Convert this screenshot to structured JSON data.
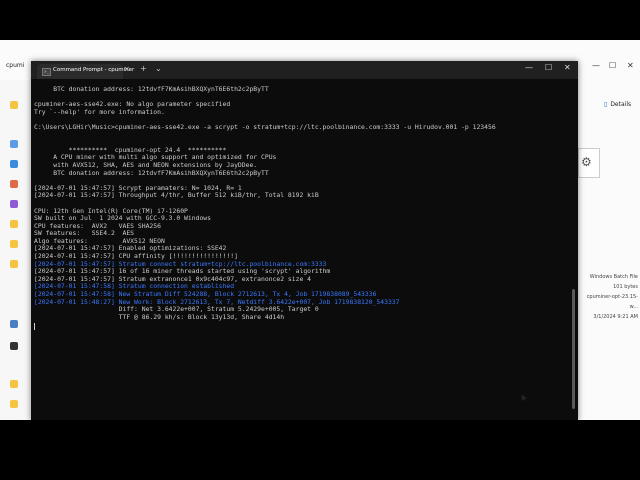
{
  "explorer": {
    "tab_label": "cpumi",
    "details_label": "Details",
    "file_type": "Windows Batch File",
    "file_size": "101 bytes",
    "file_name": "cpuminer-opt-23.15-w...",
    "file_date": "3/1/2024 9:21 AM"
  },
  "terminal": {
    "tab_title": "Command Prompt - cpuminer",
    "new_tab": "+",
    "dropdown": "⌄",
    "minimize": "—",
    "maximize": "☐",
    "close": "✕",
    "tab_close": "×"
  },
  "lines": [
    {
      "text": "     BTC donation address: 12tdvfF7KmAsihBXQXynT6E6th2c2pByTT",
      "color": "gray"
    },
    {
      "text": "",
      "color": "gray"
    },
    {
      "text": "cpuminer-aes-sse42.exe: No algo parameter specified",
      "color": "gray"
    },
    {
      "text": "Try `--help' for more information.",
      "color": "gray"
    },
    {
      "text": "",
      "color": "gray"
    },
    {
      "text": "C:\\Users\\LGHir\\Music>cpuminer-aes-sse42.exe -a scrypt -o stratum+tcp://ltc.poolbinance.com:3333 -u Hirudov.001 -p 123456",
      "color": "gray"
    },
    {
      "text": "",
      "color": "gray"
    },
    {
      "text": "",
      "color": "gray"
    },
    {
      "text": "         **********  cpuminer-opt 24.4  **********",
      "color": "gray"
    },
    {
      "text": "     A CPU miner with multi algo support and optimized for CPUs",
      "color": "gray"
    },
    {
      "text": "     with AVX512, SHA, AES and NEON extensions by JayDDee.",
      "color": "gray"
    },
    {
      "text": "     BTC donation address: 12tdvfF7KmAsihBXQXynT6E6th2c2pByTT",
      "color": "gray"
    },
    {
      "text": "",
      "color": "gray"
    },
    {
      "text": "[2024-07-01 15:47:57] Scrypt paramaters: N= 1024, R= 1",
      "color": "gray"
    },
    {
      "text": "[2024-07-01 15:47:57] Throughput 4/thr, Buffer 512 kiB/thr, Total 8192 kiB",
      "color": "gray"
    },
    {
      "text": "",
      "color": "gray"
    },
    {
      "text": "CPU: 12th Gen Intel(R) Core(TM) i7-1260P",
      "color": "gray"
    },
    {
      "text": "SW built on Jul  1 2024 with GCC-9.3.0 Windows",
      "color": "gray"
    },
    {
      "text": "CPU features:  AVX2   VAES SHA256",
      "color": "gray"
    },
    {
      "text": "SW features:   SSE4.2  AES",
      "color": "gray"
    },
    {
      "text": "Algo features:         AVX512 NEON",
      "color": "gray"
    },
    {
      "text": "[2024-07-01 15:47:57] Enabled optimizations: SSE42",
      "color": "gray"
    },
    {
      "text": "[2024-07-01 15:47:57] CPU affinity [!!!!!!!!!!!!!!!!]",
      "color": "gray"
    },
    {
      "text": "[2024-07-01 15:47:57] Stratum connect stratum+tcp://ltc.poolbinance.com:3333",
      "color": "blue"
    },
    {
      "text": "[2024-07-01 15:47:57] 16 of 16 miner threads started using 'scrypt' algorithm",
      "color": "gray"
    },
    {
      "text": "[2024-07-01 15:47:57] Stratum extranonce1 0x9c404c97, extranonce2 size 4",
      "color": "gray"
    },
    {
      "text": "[2024-07-01 15:47:58] Stratum connection established",
      "color": "blue"
    },
    {
      "text": "[2024-07-01 15:47:58] New Stratum Diff 524288, Block 2712613, Tx 4, Job 1719838089_543336",
      "color": "blue"
    },
    {
      "text": "[2024-07-01 15:48:27] New Work: Block 2712613, Tx 7, Netdiff 3.6422e+007, Job 1719838120_543337",
      "color": "blue"
    },
    {
      "text": "                      Diff: Net 3.6422e+007, Stratum 5.2429e+005, Target 0",
      "color": "gray"
    },
    {
      "text": "                      TTF @ 86.29 kh/s: Block 13y13d, Share 4d14h",
      "color": "gray"
    }
  ]
}
